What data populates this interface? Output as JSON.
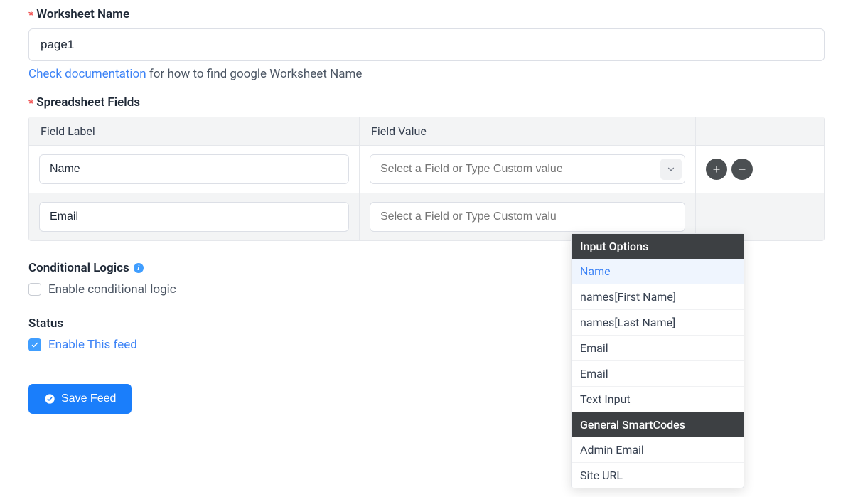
{
  "worksheet": {
    "label": "Worksheet Name",
    "value": "page1",
    "help_link": "Check documentation",
    "help_text": " for how to find google Worksheet Name"
  },
  "spreadsheet": {
    "label": "Spreadsheet Fields",
    "col_label": "Field Label",
    "col_value": "Field Value",
    "rows": [
      {
        "label": "Name",
        "placeholder": "Select a Field or Type Custom value"
      },
      {
        "label": "Email",
        "placeholder": "Select a Field or Type Custom valu"
      }
    ]
  },
  "dropdown": {
    "groups": [
      {
        "header": "Input Options",
        "items": [
          "Name",
          "names[First Name]",
          "names[Last Name]",
          "Email",
          "Email",
          "Text Input"
        ]
      },
      {
        "header": "General SmartCodes",
        "items": [
          "Admin Email",
          "Site URL"
        ]
      }
    ],
    "highlighted": "Name"
  },
  "conditional": {
    "label": "Conditional Logics",
    "checkbox_label": "Enable conditional logic"
  },
  "status": {
    "label": "Status",
    "checkbox_label": "Enable This feed"
  },
  "save_button": "Save Feed"
}
